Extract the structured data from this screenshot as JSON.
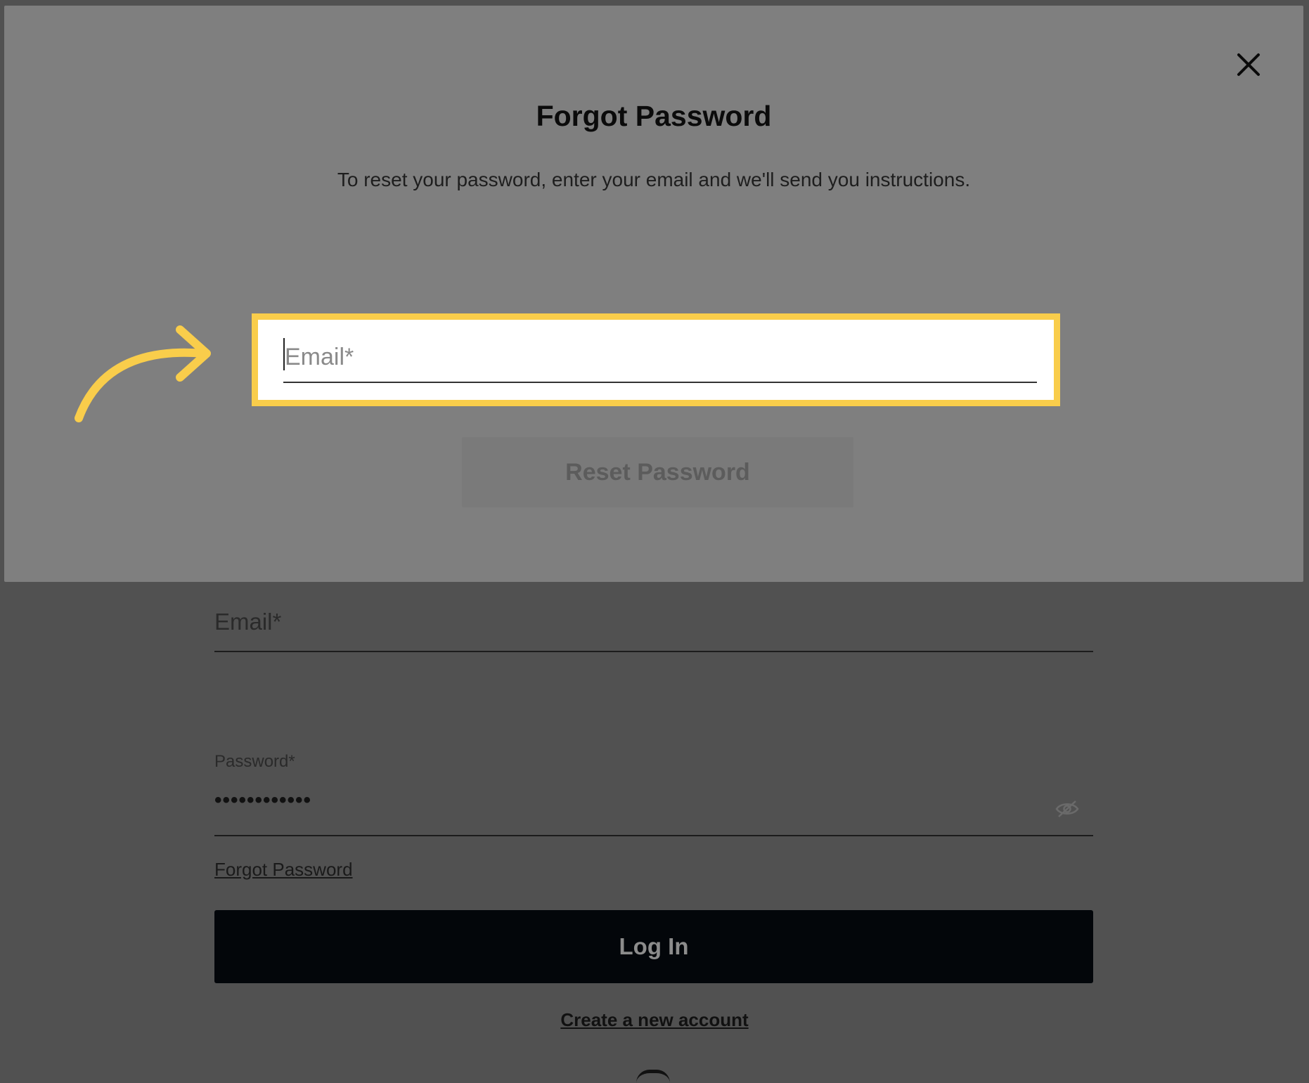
{
  "modal": {
    "title": "Forgot Password",
    "subtitle": "To reset your password, enter your email and we'll send you instructions.",
    "email_placeholder": "Email*",
    "reset_button_label": "Reset Password",
    "close_icon": "close-icon",
    "highlight_color": "#f9cd4b"
  },
  "login": {
    "email_label": "Email*",
    "password_label": "Password*",
    "password_value": "••••••••••••",
    "password_toggle_icon": "eye-slash-icon",
    "forgot_password_link": "Forgot Password",
    "login_button_label": "Log In",
    "create_account_link": "Create a new account"
  },
  "annotation": {
    "arrow_icon": "curved-arrow-icon",
    "arrow_color": "#f9cd4b"
  }
}
